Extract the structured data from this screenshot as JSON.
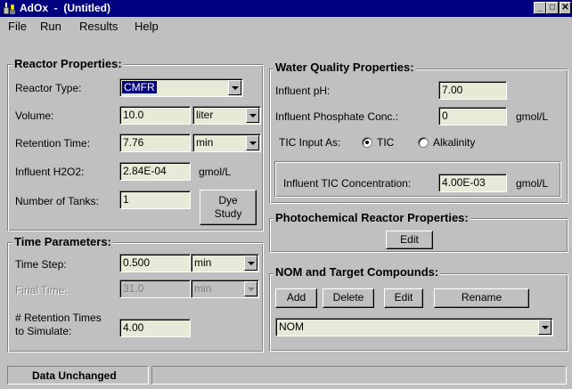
{
  "window": {
    "title": "AdOx  -  (Untitled)",
    "controls": {
      "minimize": "_",
      "maximize": "□",
      "close": "✕"
    }
  },
  "menu": {
    "file": "File",
    "run": "Run",
    "results": "Results",
    "help": "Help"
  },
  "reactor": {
    "title": "Reactor Properties:",
    "type_label": "Reactor Type:",
    "type_value": "CMFR",
    "volume_label": "Volume:",
    "volume_value": "10.0",
    "volume_unit": "liter",
    "retention_label": "Retention Time:",
    "retention_value": "7.76",
    "retention_unit": "min",
    "h2o2_label": "Influent H2O2:",
    "h2o2_value": "2.84E-04",
    "h2o2_unit": "gmol/L",
    "tanks_label": "Number of Tanks:",
    "tanks_value": "1",
    "dye_button": "Dye Study"
  },
  "time": {
    "title": "Time Parameters:",
    "step_label": "Time Step:",
    "step_value": "0.500",
    "step_unit": "min",
    "final_label": "Final Time:",
    "final_value": "31.0",
    "final_unit": "min",
    "retention_times_label_1": "# Retention Times",
    "retention_times_label_2": "to Simulate:",
    "retention_times_value": "4.00"
  },
  "water": {
    "title": "Water Quality Properties:",
    "ph_label": "Influent pH:",
    "ph_value": "7.00",
    "phosphate_label": "Influent Phosphate Conc.:",
    "phosphate_value": "0",
    "phosphate_unit": "gmol/L",
    "tic_input_label": "TIC Input As:",
    "tic_option": "TIC",
    "alkalinity_option": "Alkalinity",
    "tic_selected": "TIC",
    "tic_conc_label": "Influent TIC Concentration:",
    "tic_conc_value": "4.00E-03",
    "tic_conc_unit": "gmol/L"
  },
  "photo": {
    "title": "Photochemical Reactor Properties:",
    "edit_button": "Edit"
  },
  "nom": {
    "title": "NOM and Target Compounds:",
    "add_button": "Add",
    "delete_button": "Delete",
    "edit_button": "Edit",
    "rename_button": "Rename",
    "selected_compound": "NOM"
  },
  "status": {
    "message": "Data Unchanged",
    "secondary": ""
  },
  "colors": {
    "titlebar": "#000080",
    "face": "#c0c0c0",
    "field": "#e8ead8"
  }
}
